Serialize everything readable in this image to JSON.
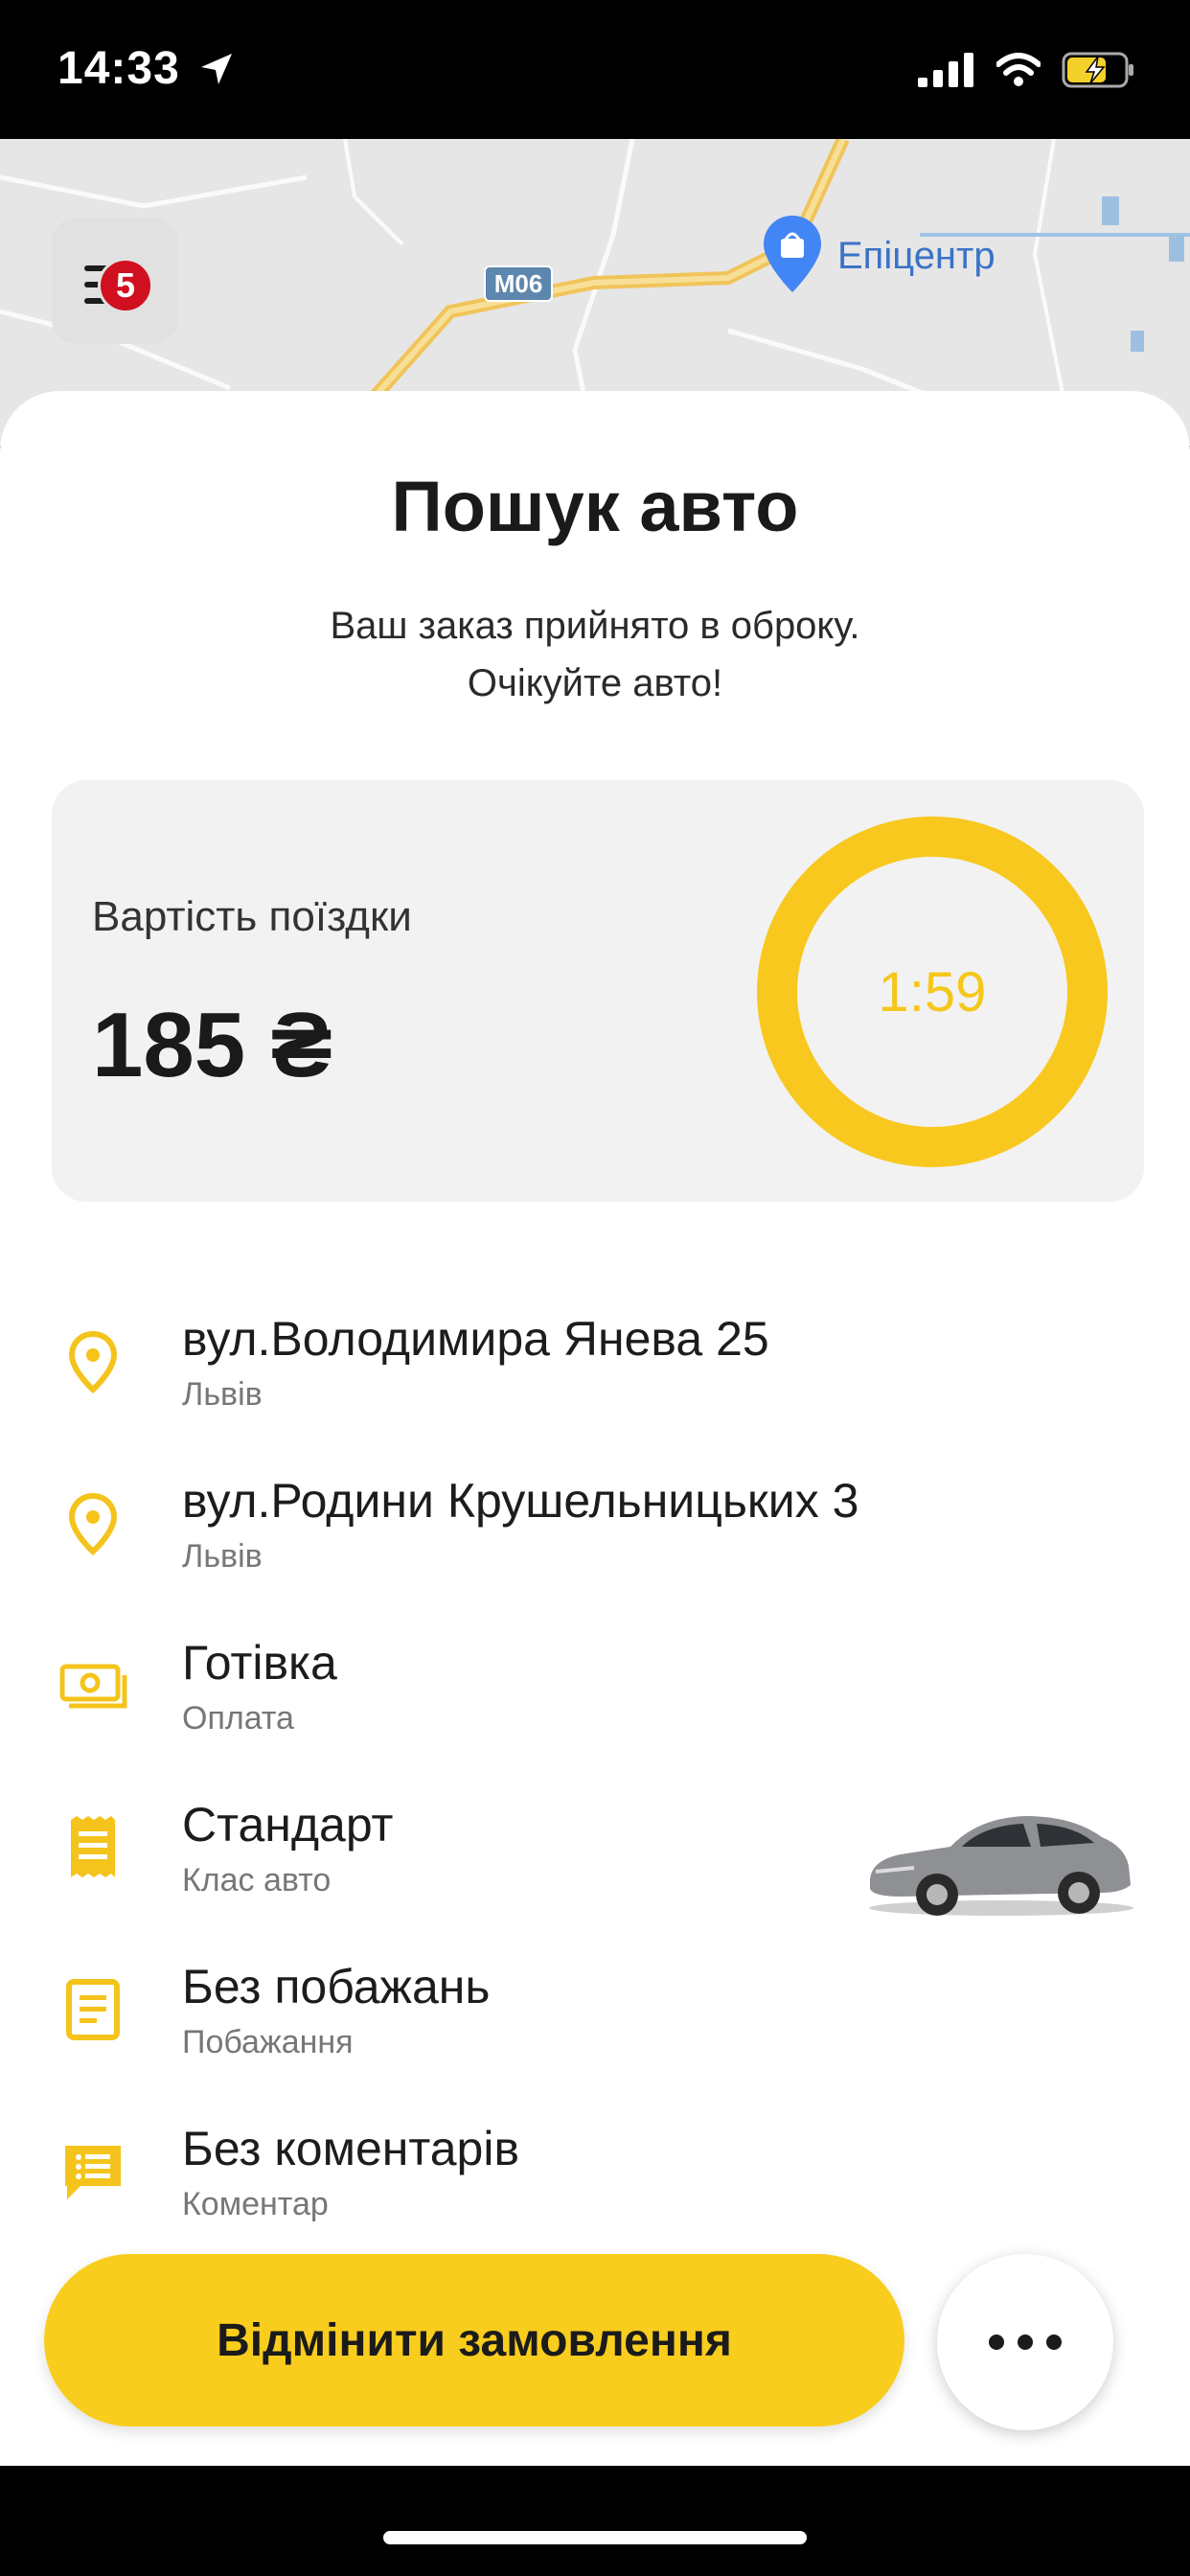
{
  "status": {
    "time": "14:33"
  },
  "map": {
    "menu_badge_count": "5",
    "road_label": "M06",
    "poi_label": "Епіцентр"
  },
  "sheet": {
    "title": "Пошук авто",
    "subtitle_line1": "Ваш заказ прийнято в оброку.",
    "subtitle_line2": "Очікуйте авто!",
    "price_label": "Вартість поїздки",
    "price_value": "185 ₴",
    "timer": "1:59",
    "details": [
      {
        "icon": "location-pin-icon",
        "main": "вул.Володимира Янева 25",
        "sub": "Львів"
      },
      {
        "icon": "location-pin-icon",
        "main": "вул.Родини Крушельницьких 3",
        "sub": "Львів"
      },
      {
        "icon": "cash-icon",
        "main": "Готівка",
        "sub": "Оплата"
      },
      {
        "icon": "receipt-icon",
        "main": "Стандарт",
        "sub": "Клас авто"
      },
      {
        "icon": "note-icon",
        "main": "Без побажань",
        "sub": "Побажання"
      },
      {
        "icon": "comment-icon",
        "main": "Без коментарів",
        "sub": "Коментар"
      }
    ],
    "cancel_label": "Відмінити замовлення"
  },
  "colors": {
    "accent": "#f9cd1d",
    "badge": "#d01020",
    "timer_text": "#f5c71a"
  }
}
